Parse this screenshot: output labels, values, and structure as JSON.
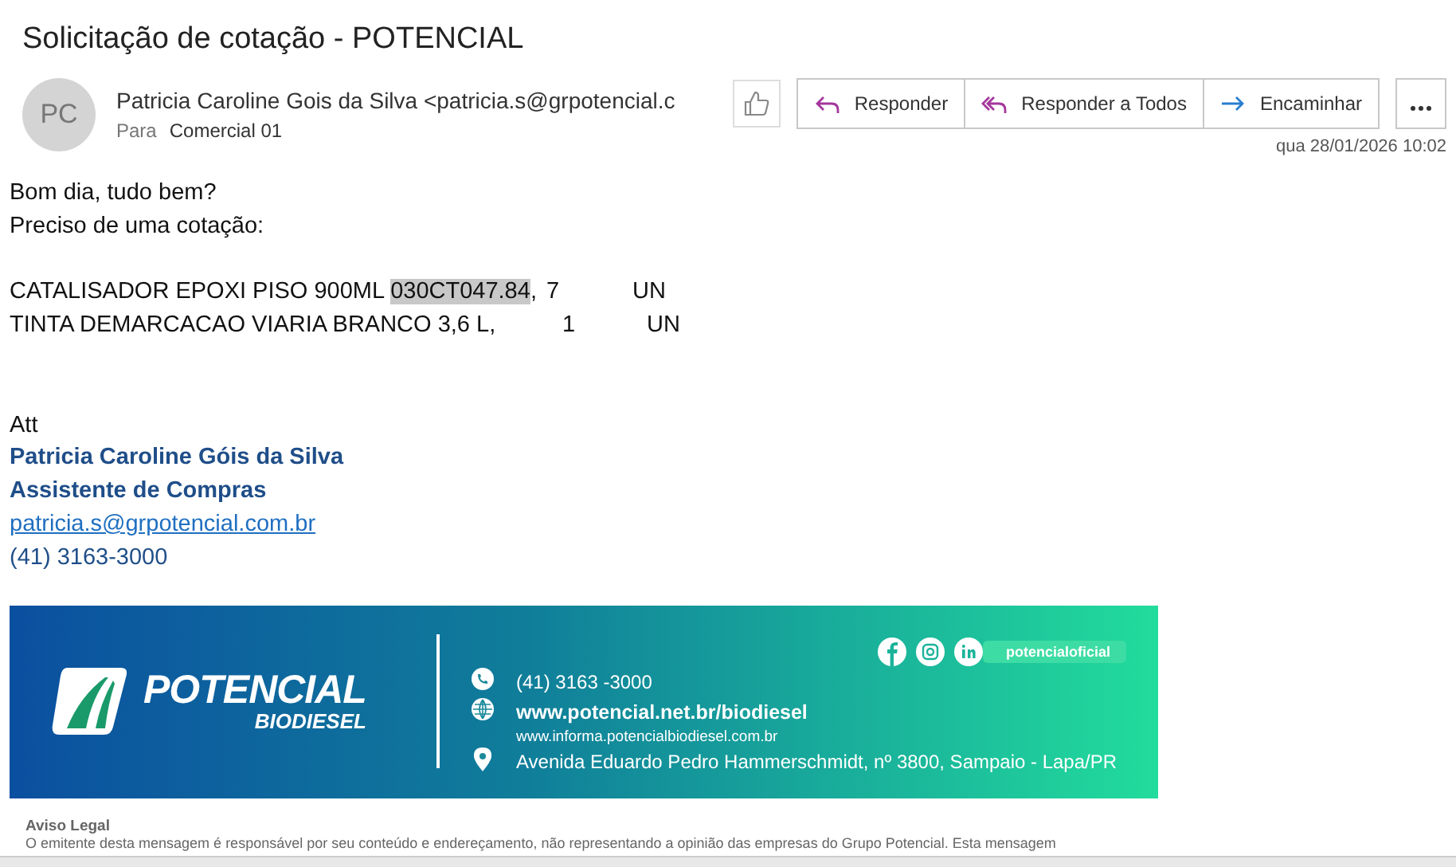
{
  "subject": "Solicitação de cotação - POTENCIAL",
  "sender": {
    "initials": "PC",
    "name": "Patricia Caroline Gois da Silva <patricia.s@grpotencial.c",
    "to_label": "Para",
    "to": "Comercial 01",
    "date": "qua 28/01/2026 10:02"
  },
  "actions": [
    {
      "kind": "reply",
      "label": "Responder"
    },
    {
      "kind": "reply_all",
      "label": "Responder a Todos"
    },
    {
      "kind": "forward",
      "label": "Encaminhar"
    }
  ],
  "body": {
    "greeting": [
      "Bom dia, tudo bem?",
      "Preciso de uma cotação:"
    ],
    "items": [
      {
        "name": "CATALISADOR EPOXI PISO 900ML ",
        "code": "030CT047.84",
        "tail": ",",
        "qty": "7",
        "unit": "UN"
      },
      {
        "name": "TINTA DEMARCACAO VIARIA BRANCO 3,6 L,",
        "qty": "1",
        "unit": "UN"
      }
    ],
    "closing": "Att"
  },
  "signature": {
    "name": "Patricia Caroline Góis da Silva",
    "role": "Assistente de Compras",
    "email": "patricia.s@grpotencial.com.br",
    "phone": "(41) 3163-3000"
  },
  "banner": {
    "brand": "POTENCIAL",
    "sub": "BIODIESEL",
    "social": "potencialoficial",
    "contacts": [
      {
        "kind": "phone",
        "text": "(41) 3163 -3000"
      },
      {
        "kind": "web",
        "text": "www.potencial.net.br/biodiesel",
        "extra": "www.informa.potencialbiodiesel.com.br"
      },
      {
        "kind": "location",
        "text": "Avenida Eduardo Pedro Hammerschmidt, nº 3800, Sampaio - Lapa/PR"
      }
    ]
  },
  "legal": {
    "title": "Aviso Legal",
    "text": "O emitente desta mensagem é responsável por seu conteúdo e endereçamento, não representando a opinião das empresas do Grupo Potencial. Esta mensagem"
  }
}
